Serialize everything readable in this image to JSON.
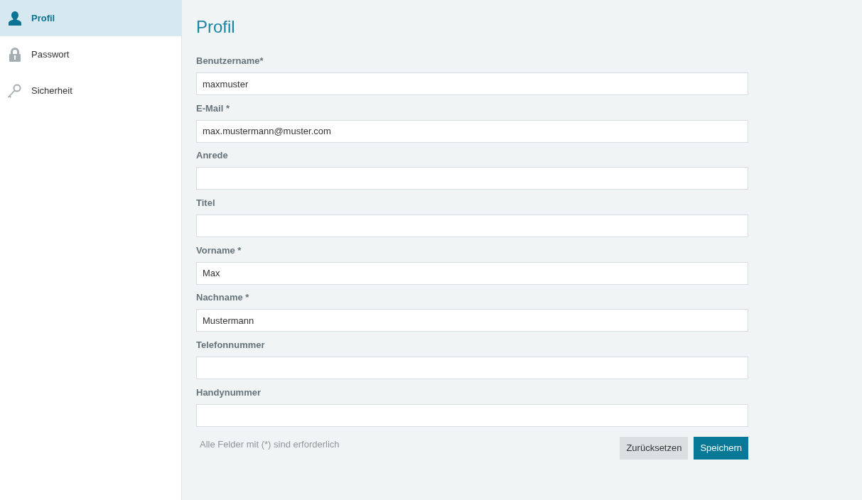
{
  "sidebar": {
    "items": [
      {
        "label": "Profil",
        "selected": true
      },
      {
        "label": "Passwort",
        "selected": false
      },
      {
        "label": "Sicherheit",
        "selected": false
      }
    ]
  },
  "page_title": "Profil",
  "form": {
    "fields": [
      {
        "label": "Benutzername*",
        "value": "maxmuster"
      },
      {
        "label": "E-Mail *",
        "value": "max.mustermann@muster.com"
      },
      {
        "label": "Anrede"
      },
      {
        "label": "Titel"
      },
      {
        "label": "Vorname *",
        "value": "Max"
      },
      {
        "label": "Nachname *",
        "value": "Mustermann"
      },
      {
        "label": "Telefonnummer"
      },
      {
        "label": "Handynummer"
      }
    ],
    "note": "Alle Felder mit (*) sind erforderlich",
    "buttons": [
      {
        "label": "Zurücksetzen",
        "kind": "secondary"
      },
      {
        "label": "Speichern",
        "kind": "primary"
      }
    ]
  }
}
